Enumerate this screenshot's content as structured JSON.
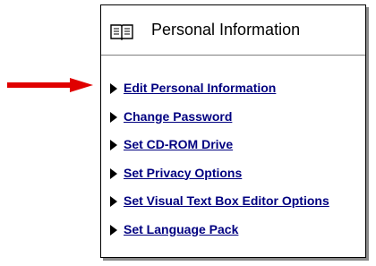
{
  "panel": {
    "title": "Personal Information",
    "header_icon": "book-icon"
  },
  "annotation": {
    "icon": "red-arrow-icon",
    "color": "#e00000"
  },
  "menu": {
    "bullet_icon": "triangle-right-icon",
    "items": [
      {
        "label": "Edit Personal Information"
      },
      {
        "label": "Change Password"
      },
      {
        "label": "Set CD-ROM Drive"
      },
      {
        "label": "Set Privacy Options"
      },
      {
        "label": "Set Visual Text Box Editor Options"
      },
      {
        "label": "Set Language Pack"
      }
    ]
  },
  "colors": {
    "link": "#000080",
    "border": "#000000",
    "shadow": "#8a8a8a"
  }
}
